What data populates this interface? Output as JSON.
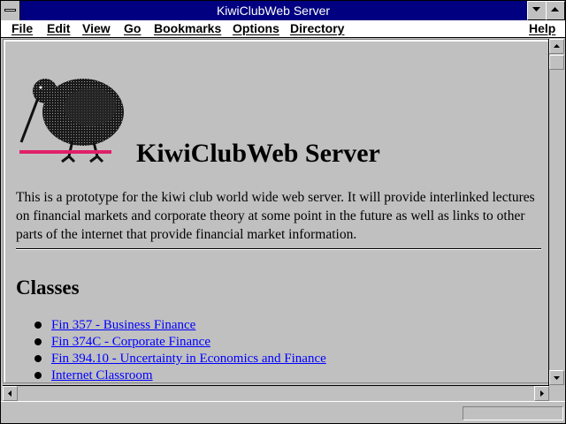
{
  "window": {
    "title": "KiwiClubWeb Server"
  },
  "menubar": {
    "items": [
      "File",
      "Edit",
      "View",
      "Go",
      "Bookmarks",
      "Options",
      "Directory",
      "Help"
    ]
  },
  "page": {
    "heading": "KiwiClubWeb Server",
    "intro": "This is a prototype for the kiwi club world wide web server. It will provide interlinked lectures on financial markets and corporate theory at some point in the future as well as links to other parts of the internet that provide financial market information.",
    "classes_heading": "Classes",
    "classes": [
      "Fin 357 - Business Finance",
      "Fin 374C - Corporate Finance",
      "Fin 394.10 - Uncertainty in Economics and Finance",
      "Internet Classroom"
    ],
    "link_color": "#0000ff"
  },
  "icons": {
    "system_menu": "system-menu-icon",
    "minimize": "triangle-down-icon",
    "maximize": "triangle-up-icon",
    "scroll_up": "arrow-up-icon",
    "scroll_down": "arrow-down-icon",
    "scroll_left": "arrow-left-icon",
    "scroll_right": "arrow-right-icon",
    "logo": "kiwi-bird-icon"
  },
  "colors": {
    "titlebar": "#000080",
    "window_bg": "#c0c0c0",
    "logo_stripe": "#e0206a"
  }
}
